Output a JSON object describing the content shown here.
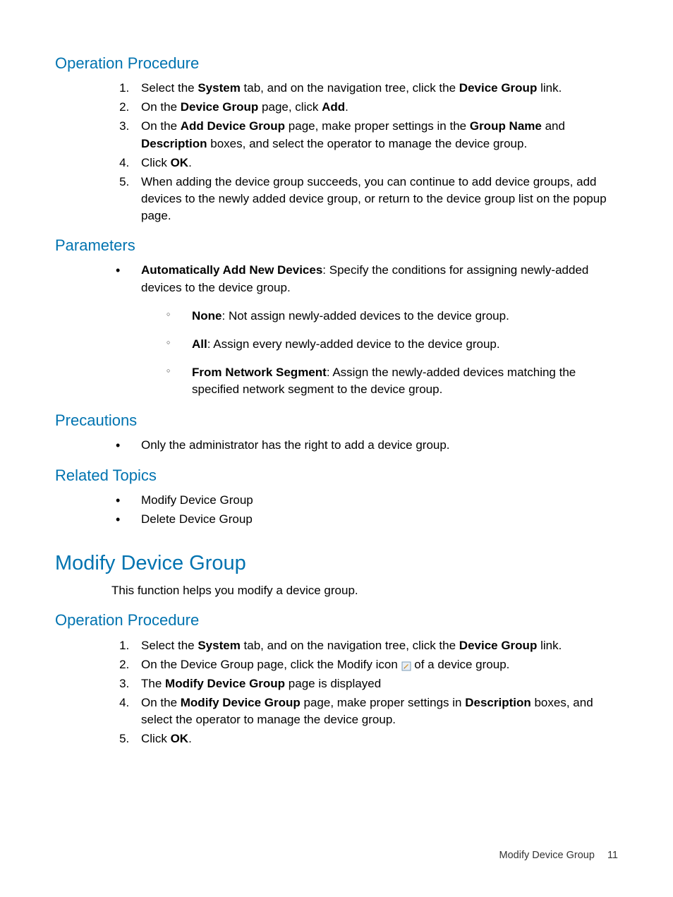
{
  "sec1": {
    "heading": "Operation Procedure",
    "steps": {
      "s1a": "Select the ",
      "s1b": "System",
      "s1c": " tab, and on the navigation tree, click the ",
      "s1d": "Device Group",
      "s1e": " link.",
      "s2a": "On the ",
      "s2b": "Device Group",
      "s2c": " page, click ",
      "s2d": "Add",
      "s2e": ".",
      "s3a": "On the ",
      "s3b": "Add Device Group",
      "s3c": " page, make proper settings in the ",
      "s3d": "Group Name",
      "s3e": " and ",
      "s3f": "Description",
      "s3g": " boxes, and select the operator to manage the device group.",
      "s4a": "Click ",
      "s4b": "OK",
      "s4c": ".",
      "s5": "When adding the device group succeeds, you can continue to add device groups, add devices to the newly added device group, or return to the device group list on the popup page."
    }
  },
  "sec2": {
    "heading": "Parameters",
    "p1a": "Automatically Add New Devices",
    "p1b": ": Specify the conditions for assigning newly-added devices to the device group.",
    "sub1a": "None",
    "sub1b": ": Not assign newly-added devices to the device group.",
    "sub2a": "All",
    "sub2b": ": Assign every newly-added device to the device group.",
    "sub3a": "From Network Segment",
    "sub3b": ": Assign the newly-added devices matching the specified network segment to the device group."
  },
  "sec3": {
    "heading": "Precautions",
    "p1": "Only the administrator has the right to add a device group."
  },
  "sec4": {
    "heading": "Related Topics",
    "p1": "Modify Device Group",
    "p2": "Delete Device Group"
  },
  "sec5": {
    "heading": "Modify Device Group",
    "intro": "This function helps you modify a device group."
  },
  "sec6": {
    "heading": "Operation Procedure",
    "steps": {
      "s1a": "Select the ",
      "s1b": "System",
      "s1c": " tab, and on the navigation tree, click the ",
      "s1d": "Device Group",
      "s1e": " link.",
      "s2a": "On the Device Group page, click the Modify icon ",
      "s2b": " of a device group.",
      "s3a": "The ",
      "s3b": "Modify Device Group",
      "s3c": " page is displayed",
      "s4a": "On the ",
      "s4b": "Modify Device Group",
      "s4c": " page, make proper settings in ",
      "s4d": "Description",
      "s4e": " boxes, and select the operator to manage the device group.",
      "s5a": "Click ",
      "s5b": "OK",
      "s5c": "."
    }
  },
  "footer": {
    "title": "Modify Device Group",
    "page": "11"
  }
}
